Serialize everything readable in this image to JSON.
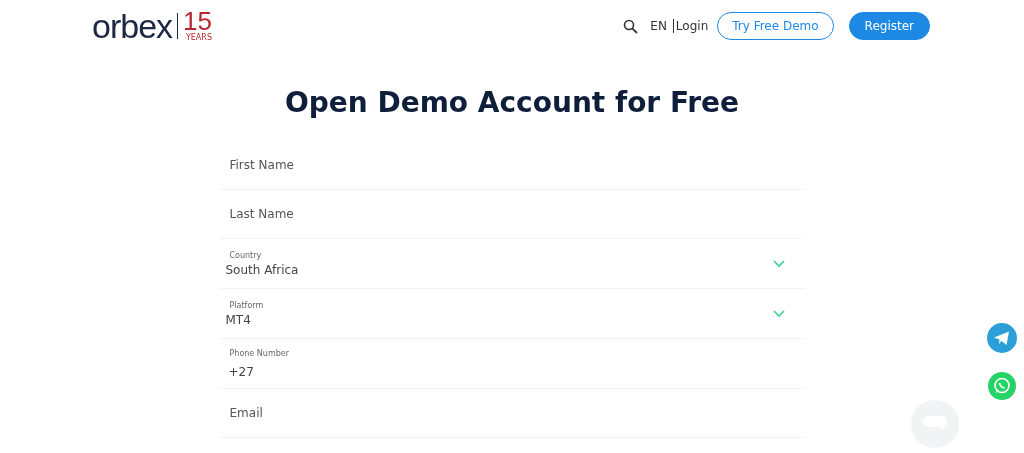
{
  "header": {
    "logo": {
      "name": "orbex",
      "badge": "15",
      "badge_caption": "YEARS"
    },
    "nav": {
      "language": "EN",
      "login": "Login",
      "demo_button": "Try Free Demo",
      "register_button": "Register"
    }
  },
  "title": "Open Demo Account for Free",
  "form": {
    "fields": [
      {
        "kind": "text",
        "placeholder": "First Name"
      },
      {
        "kind": "text",
        "placeholder": "Last Name"
      },
      {
        "kind": "select",
        "label": "Country",
        "value": "South Africa"
      },
      {
        "kind": "select",
        "label": "Platform",
        "value": "MT4"
      },
      {
        "kind": "phone",
        "label": "Phone Number",
        "value": "+27"
      },
      {
        "kind": "text",
        "placeholder": "Email"
      }
    ]
  }
}
